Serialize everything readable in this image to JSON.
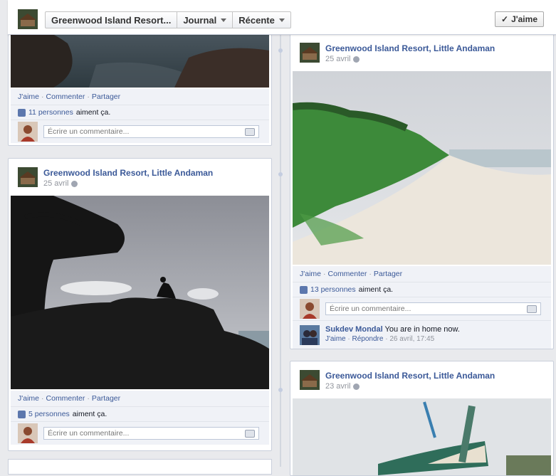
{
  "topbar": {
    "page_name": "Greenwood Island Resort...",
    "section": "Journal",
    "sort": "Récente",
    "like_button": "J'aime",
    "like_check": "✓"
  },
  "common": {
    "page_title": "Greenwood Island Resort, Little Andaman",
    "action_like": "J'aime",
    "action_comment": "Commenter",
    "action_share": "Partager",
    "separator": "·",
    "comment_placeholder": "Écrire un commentaire...",
    "people_suffix": "aiment ça."
  },
  "posts": [
    {
      "date": "",
      "likes": "11 personnes"
    },
    {
      "date": "25 avril",
      "likes": "5 personnes"
    },
    {
      "date": "25 avril",
      "likes": "13 personnes",
      "comment": {
        "author": "Sukdev Mondal",
        "text": "You are in home now.",
        "like": "J'aime",
        "reply": "Répondre",
        "time": "26 avril, 17:45"
      }
    },
    {
      "date": "23 avril"
    }
  ],
  "colors": {
    "link": "#3b5998",
    "panel": "#f0f2f7",
    "bg": "#e9eaed"
  }
}
